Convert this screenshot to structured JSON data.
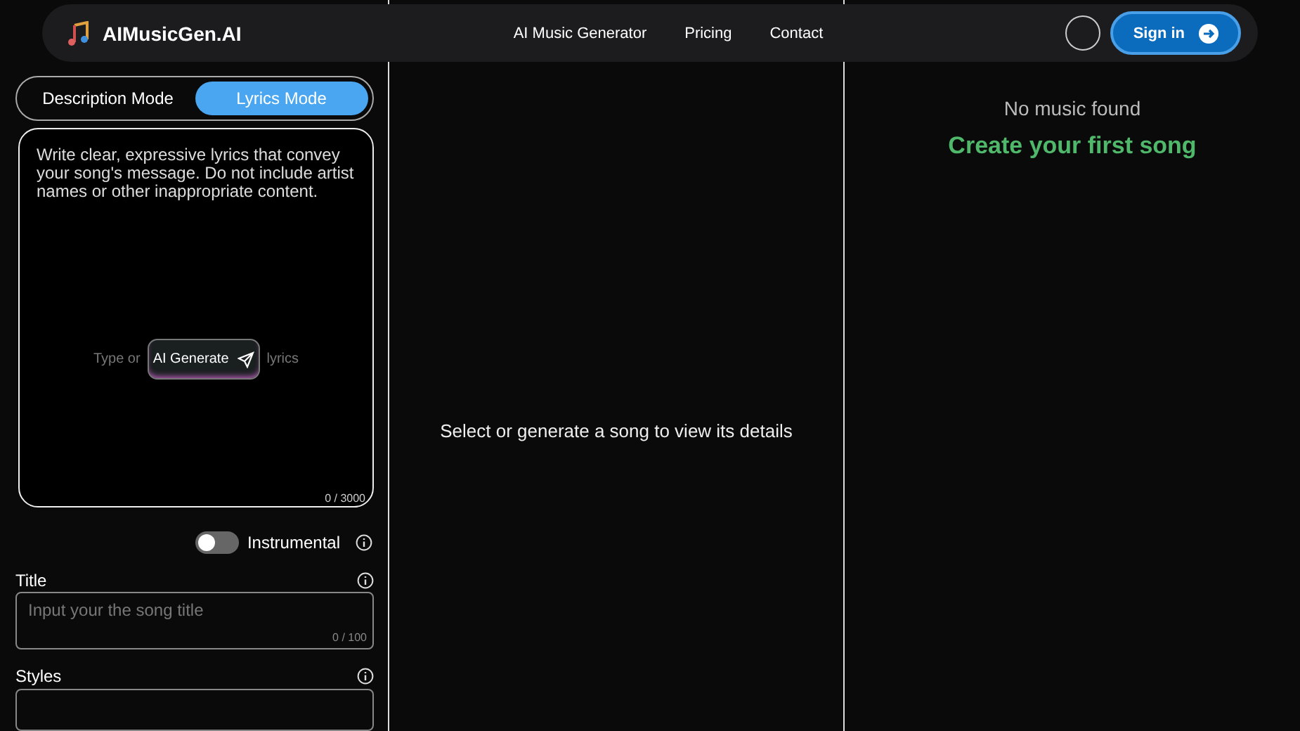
{
  "header": {
    "logo": "AIMusicGen.AI",
    "nav": [
      "AI Music Generator",
      "Pricing",
      "Contact"
    ],
    "sign_in": "Sign in"
  },
  "modes": [
    {
      "label": "Description Mode",
      "selected": false
    },
    {
      "label": "Lyrics Mode",
      "selected": true
    }
  ],
  "lyrics": {
    "placeholder": "Write clear, expressive lyrics that convey your song's message. Do not include artist names or other inappropriate content.",
    "hint_before": "Type or",
    "ai_button": "AI Generate",
    "hint_after": "lyrics",
    "counter": "0 / 3000"
  },
  "instrumental": {
    "label": "Instrumental",
    "on": false
  },
  "title_field": {
    "label": "Title",
    "placeholder": "Input your the song title",
    "counter": "0 / 100"
  },
  "styles_field": {
    "label": "Styles"
  },
  "details": {
    "message": "Select or generate a song to view its details"
  },
  "library": {
    "empty": "No music found",
    "cta": "Create your first song"
  }
}
